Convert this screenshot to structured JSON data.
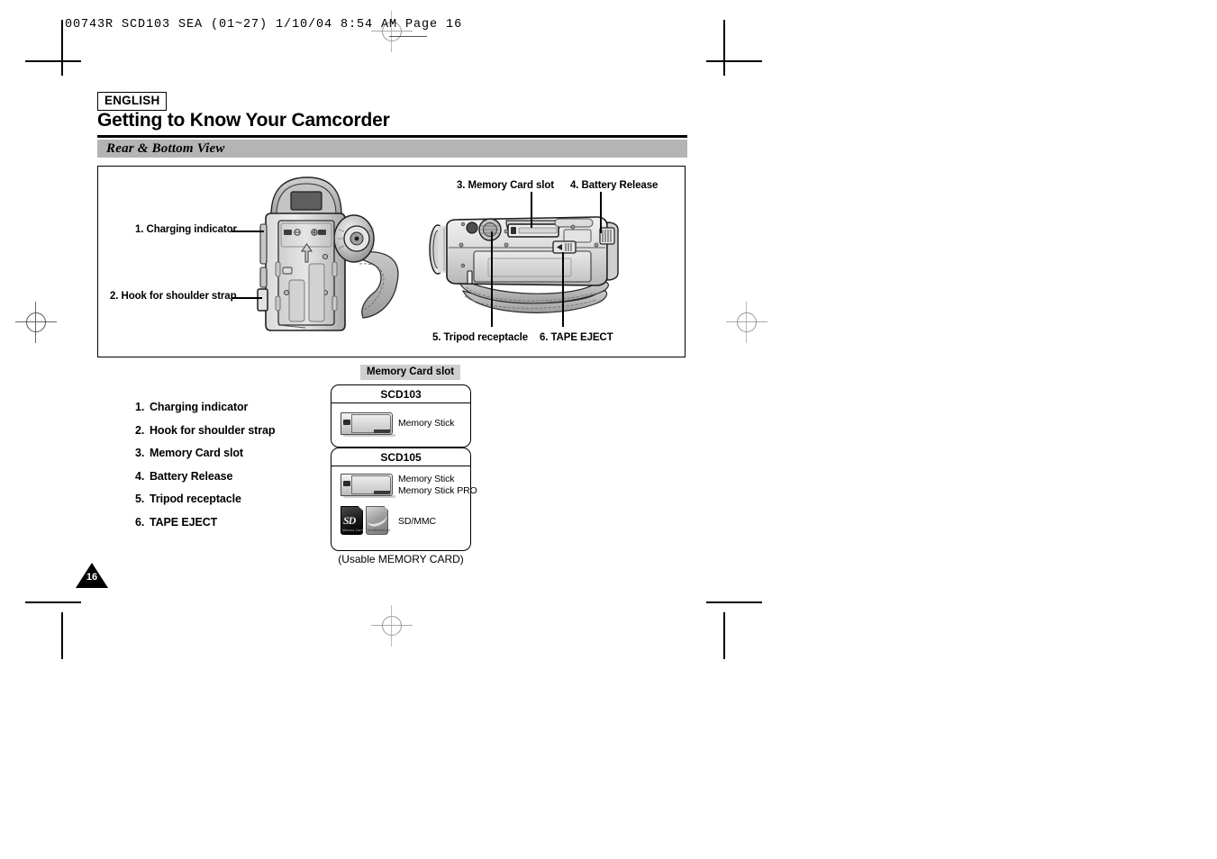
{
  "printer_slug": "00743R SCD103 SEA (01~27)   1/10/04 8:54 AM   Page 16",
  "header": {
    "language_badge": "ENGLISH",
    "title": "Getting to Know Your Camcorder",
    "section": "Rear & Bottom View"
  },
  "figure": {
    "callouts": [
      {
        "id": "charging-indicator",
        "text": "1. Charging indicator"
      },
      {
        "id": "hook-shoulder-strap",
        "text": "2. Hook for shoulder strap"
      },
      {
        "id": "memory-card-slot",
        "text": "3. Memory Card slot"
      },
      {
        "id": "battery-release",
        "text": "4. Battery Release"
      },
      {
        "id": "tripod-receptacle",
        "text": "5. Tripod receptacle"
      },
      {
        "id": "tape-eject",
        "text": "6. TAPE EJECT"
      }
    ]
  },
  "parts_list": [
    {
      "index": "1.",
      "label": "Charging indicator"
    },
    {
      "index": "2.",
      "label": "Hook for shoulder strap"
    },
    {
      "index": "3.",
      "label": "Memory Card slot"
    },
    {
      "index": "4.",
      "label": "Battery Release"
    },
    {
      "index": "5.",
      "label": "Tripod receptacle"
    },
    {
      "index": "6.",
      "label": "TAPE EJECT"
    }
  ],
  "memory_card_panel": {
    "badge": "Memory Card slot",
    "caption": "(Usable MEMORY CARD)",
    "models": [
      {
        "name": "SCD103",
        "cards": [
          {
            "type": "memory-stick",
            "labels": [
              "Memory Stick"
            ]
          }
        ]
      },
      {
        "name": "SCD105",
        "cards": [
          {
            "type": "memory-stick",
            "labels": [
              "Memory Stick",
              "Memory Stick PRO"
            ]
          },
          {
            "type": "sd-mmc",
            "labels": [
              "SD/MMC"
            ]
          }
        ]
      }
    ],
    "card_face_text": {
      "sd_logo": "SD",
      "sd_sub": "Memory Card",
      "mmc_sub": "MultiMediaCard",
      "ms_sub": "Memory Stick"
    }
  },
  "footer": {
    "page_number": "16"
  },
  "colors": {
    "section_bar": "#b4b4b4",
    "badge_bg": "#cfcfcf",
    "ink": "#000000",
    "page_bg": "#ffffff"
  }
}
